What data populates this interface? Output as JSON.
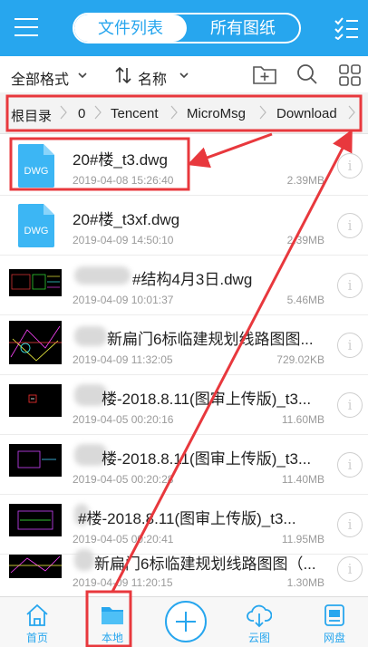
{
  "header": {
    "tabs": [
      {
        "label": "文件列表",
        "active": true
      },
      {
        "label": "所有图纸",
        "active": false
      }
    ],
    "accent_color": "#27a6ee"
  },
  "toolbar": {
    "format_label": "全部格式",
    "sort_label": "名称",
    "icons": [
      "new-folder-icon",
      "search-icon",
      "grid-view-icon"
    ]
  },
  "breadcrumb": [
    "根目录",
    "0",
    "Tencent",
    "MicroMsg",
    "Download"
  ],
  "files": [
    {
      "name": "20#楼_t3.dwg",
      "date": "2019-04-08 15:26:40",
      "size": "2.39MB",
      "thumb": "dwg"
    },
    {
      "name": "20#楼_t3xf.dwg",
      "date": "2019-04-09 14:50:10",
      "size": "2.39MB",
      "thumb": "dwg"
    },
    {
      "name": "#结构4月3日.dwg",
      "date": "2019-04-09 10:01:37",
      "size": "5.46MB",
      "thumb": "drawing"
    },
    {
      "name": "新扁门6标临建规划线路图图...",
      "date": "2019-04-09 11:32:05",
      "size": "729.02KB",
      "thumb": "drawing"
    },
    {
      "name": "楼-2018.8.11(图审上传版)_t3...",
      "date": "2019-04-05 00:20:16",
      "size": "11.60MB",
      "thumb": "drawing"
    },
    {
      "name": "楼-2018.8.11(图审上传版)_t3...",
      "date": "2019-04-05 00:20:28",
      "size": "11.40MB",
      "thumb": "drawing"
    },
    {
      "name": "#楼-2018.8.11(图审上传版)_t3...",
      "date": "2019-04-05 00:20:41",
      "size": "11.95MB",
      "thumb": "drawing"
    },
    {
      "name": "新扁门6标临建规划线路图图（...",
      "date": "2019-04-09 11:20:15",
      "size": "1.30MB",
      "thumb": "drawing"
    }
  ],
  "dwg_label": "DWG",
  "info_glyph": "i",
  "bottom_nav": [
    {
      "label": "首页",
      "icon": "home-icon"
    },
    {
      "label": "本地",
      "icon": "folder-icon",
      "active": true
    },
    {
      "label": "",
      "icon": "plus-icon"
    },
    {
      "label": "云图",
      "icon": "cloud-icon"
    },
    {
      "label": "网盘",
      "icon": "disk-icon"
    }
  ],
  "annotation_color": "#e8383d"
}
